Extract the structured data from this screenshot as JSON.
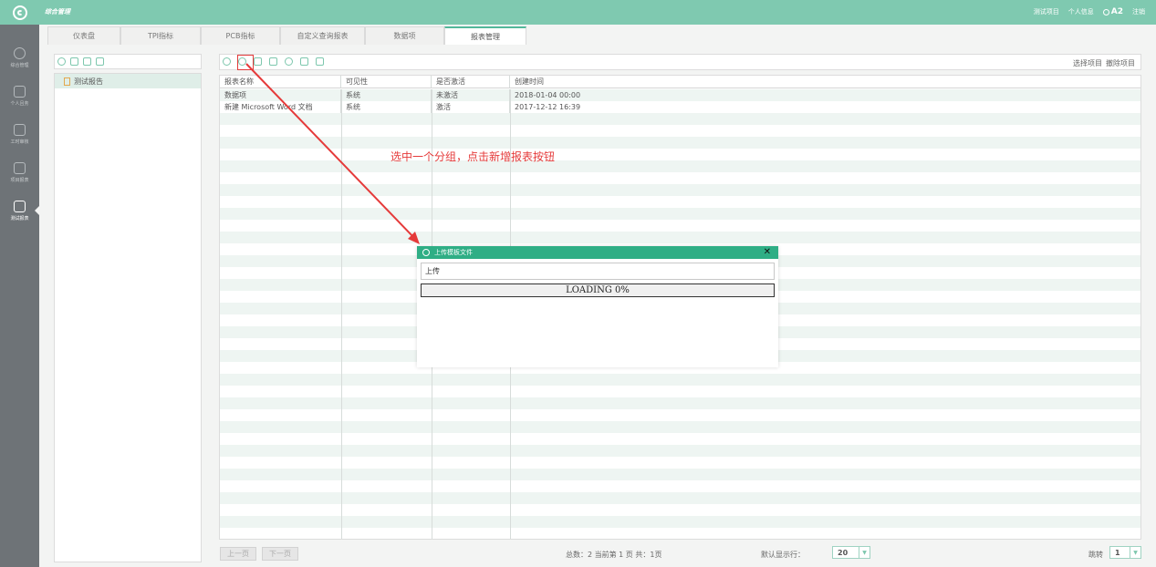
{
  "header": {
    "app_title": "综合管理",
    "test_project": "测试项目",
    "personal_info": "个人信息",
    "user": "A2",
    "logout": "注销"
  },
  "rail": {
    "items": [
      {
        "label": "综合管理",
        "icon": "gear-icon"
      },
      {
        "label": "个人且务",
        "icon": "person-icon"
      },
      {
        "label": "工时审核",
        "icon": "clock-icon"
      },
      {
        "label": "项目报表",
        "icon": "calendar-icon"
      },
      {
        "label": "测试报表",
        "icon": "report-icon",
        "active": true
      }
    ]
  },
  "tabs": [
    "仪表盘",
    "TPI指标",
    "PCB指标",
    "自定义查询报表",
    "数据项",
    "报表管理"
  ],
  "active_tab": "报表管理",
  "tree": {
    "nodes": [
      "测试报告"
    ]
  },
  "grid_toolbar": {
    "select_project": "选择项目",
    "remove_project": "撤除项目"
  },
  "grid": {
    "columns": [
      "报表名称",
      "可见性",
      "是否激活",
      "创建时间"
    ],
    "rows": [
      [
        "数据项",
        "系统",
        "未激活",
        "2018-01-04 00:00"
      ],
      [
        "新建 Microsoft Word 文档",
        "系统",
        "激活",
        "2017-12-12 16:39"
      ]
    ]
  },
  "footer": {
    "prev": "上一页",
    "next": "下一页",
    "page_info": "总数：2  当前第 1 页   共：1页",
    "default_rows_label": "默认显示行：",
    "rows_per_page": "20",
    "jump_label": "跳转",
    "jump_page": "1"
  },
  "annotation": "选中一个分组，点击新增报表按钮",
  "dialog": {
    "title": "上传模板文件",
    "close": "✕",
    "upload_label": "上传",
    "loading_text": "LOADING 0%",
    "progress": 0
  },
  "colors": {
    "header": "#7fc9b0",
    "rail": "#6e7377",
    "accent": "#2fae85",
    "annotation": "#e53a3a"
  }
}
